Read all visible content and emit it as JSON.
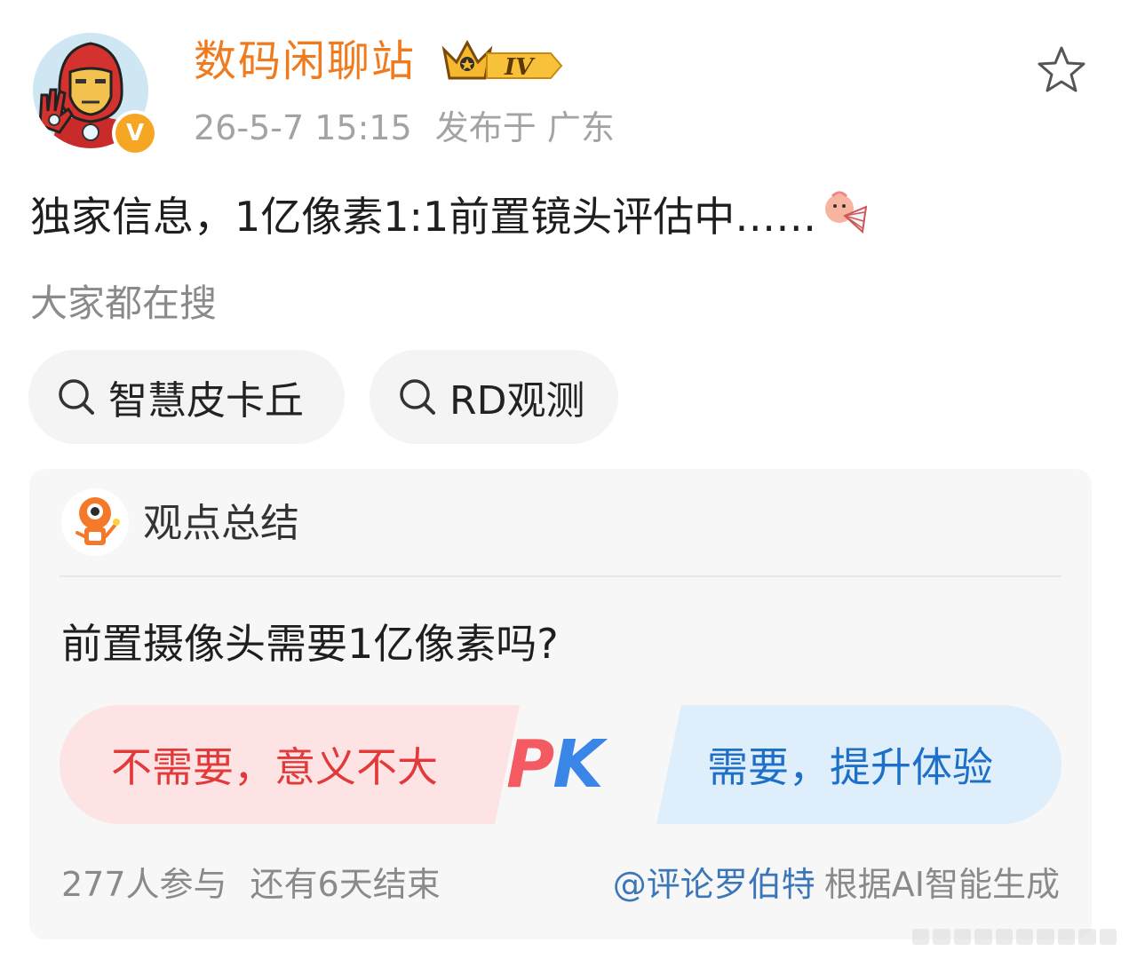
{
  "post": {
    "username": "数码闲聊站",
    "level": "IV",
    "timestamp": "26-5-7 15:15",
    "location": "发布于 广东",
    "text": "独家信息，1亿像素1:1前置镜头评估中……",
    "verify_badge": "V"
  },
  "icons": {
    "favorite": "star-outline-icon",
    "search": "search-icon",
    "emoji": "fan-emoji-icon",
    "bot": "robot-avatar-icon"
  },
  "search_section": {
    "label": "大家都在搜",
    "chips": [
      "智慧皮卡丘",
      "RD观测"
    ]
  },
  "summary_card": {
    "title": "观点总结",
    "question": "前置摄像头需要1亿像素吗?",
    "option_left": "不需要，意义不大",
    "option_right": "需要，提升体验",
    "pk_p": "P",
    "pk_k": "K",
    "participants": "277人参与",
    "ends": "还有6天结束",
    "mention": "@评论罗伯特",
    "generated_note": "根据AI智能生成"
  },
  "colors": {
    "username": "#f07b1e",
    "left_option_bg": "#fde3e3",
    "left_option_text": "#e23a3a",
    "right_option_bg": "#dfeefb",
    "right_option_text": "#1e6fc8",
    "mention": "#3b77b8"
  }
}
